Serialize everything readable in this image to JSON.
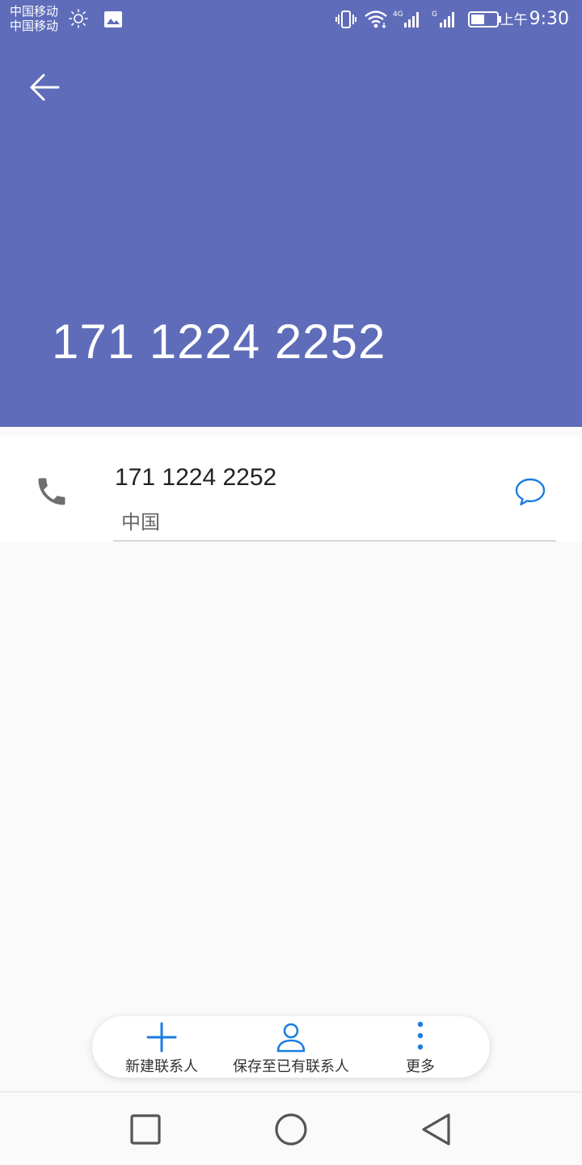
{
  "status_bar": {
    "carrier_1": "中国移动",
    "carrier_2": "中国移动",
    "network_1": "4G",
    "network_2": "G",
    "time_prefix": "上午",
    "time": "9:30",
    "icons": [
      "brightness-icon",
      "image-notification-icon",
      "vibrate-icon",
      "wifi-icon",
      "signal-icon",
      "battery-icon"
    ]
  },
  "header": {
    "back_icon": "arrow-left-icon",
    "title_number": "171 1224 2252",
    "color": "#5f6cb9"
  },
  "detail": {
    "number": "171 1224 2252",
    "region": "中国",
    "call_icon": "phone-icon",
    "message_icon": "message-icon"
  },
  "actions": [
    {
      "icon": "plus-icon",
      "label": "新建联系人"
    },
    {
      "icon": "person-icon",
      "label": "保存至已有联系人"
    },
    {
      "icon": "more-vertical-icon",
      "label": "更多"
    }
  ],
  "accent_color": "#1a7de0",
  "nav_bar": [
    "recents-square-icon",
    "home-circle-icon",
    "back-triangle-icon"
  ]
}
